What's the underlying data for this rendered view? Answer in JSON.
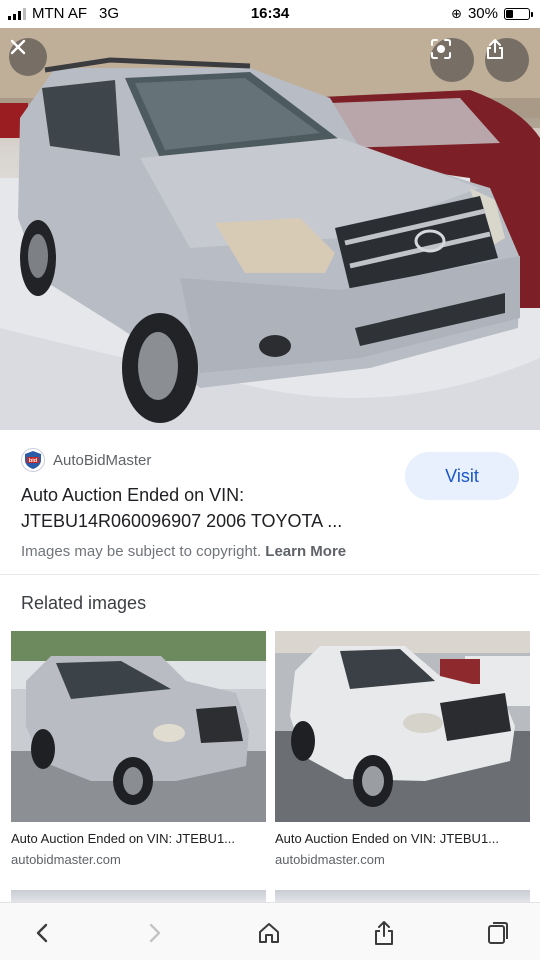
{
  "status_bar": {
    "carrier": "MTN AF",
    "network": "3G",
    "time": "16:34",
    "battery": "30%"
  },
  "hero": {
    "close_icon": "close-icon",
    "lens_icon": "lens-icon",
    "share_icon": "share-icon"
  },
  "result": {
    "source_name": "AutoBidMaster",
    "favicon_text": "bid",
    "title_line1": "Auto Auction Ended on VIN:",
    "title_line2": "JTEBU14R060096907 2006 TOYOTA ...",
    "visit_label": "Visit",
    "copyright_text": "Images may be subject to copyright.",
    "learn_more_label": "Learn More"
  },
  "related": {
    "heading": "Related images",
    "items": [
      {
        "caption": "Auto Auction Ended on VIN: JTEBU1...",
        "domain": "autobidmaster.com"
      },
      {
        "caption": "Auto Auction Ended on VIN: JTEBU1...",
        "domain": "autobidmaster.com"
      }
    ]
  },
  "toolbar": {
    "back_icon": "back-arrow-icon",
    "forward_icon": "forward-arrow-icon",
    "home_icon": "home-icon",
    "share_icon": "share-icon",
    "tabs_icon": "tabs-icon"
  },
  "colors": {
    "accent": "#1a56c8",
    "visit_bg": "#e8f0fe",
    "car_silver": "#b8bcc4"
  }
}
